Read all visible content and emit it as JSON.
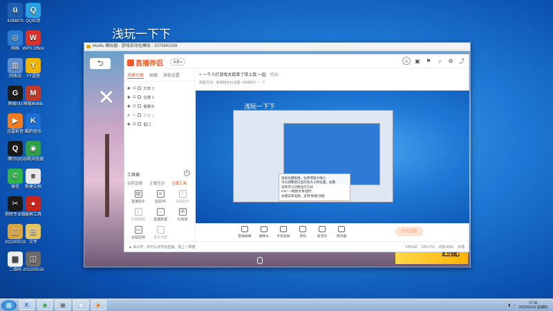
{
  "desktop": {
    "icons": [
      {
        "label": "4298879",
        "glyph": "ü",
        "color": "#1f5fb0"
      },
      {
        "label": "QQ应用",
        "glyph": "Q",
        "color": "#2aa0e0"
      },
      {
        "label": "网络",
        "glyph": "◎",
        "color": "#2a7bd0"
      },
      {
        "label": "WPS Office",
        "glyph": "W",
        "color": "#d8322b"
      },
      {
        "label": "回收站",
        "glyph": "▥",
        "color": "#5d8ccf"
      },
      {
        "label": "YY语音",
        "glyph": "Y",
        "color": "#f0b400"
      },
      {
        "label": "网易UU",
        "glyph": "G",
        "color": "#1b1b1b"
      },
      {
        "label": "网易MuMu",
        "glyph": "M",
        "color": "#c03a2a"
      },
      {
        "label": "迅雷影音",
        "glyph": "▶",
        "color": "#ef7b22"
      },
      {
        "label": "酷狗音乐",
        "glyph": "K",
        "color": "#1b6ed6"
      },
      {
        "label": "腾讯QQ",
        "glyph": "Q",
        "color": "#1a1a1a"
      },
      {
        "label": "谷歌浏览器",
        "glyph": "◉",
        "color": "#2e9e49"
      },
      {
        "label": "微信",
        "glyph": "✆",
        "color": "#2fb34a"
      },
      {
        "label": "新建文档",
        "glyph": "≡",
        "color": "#e8e8e8"
      },
      {
        "label": "剪映专业版",
        "glyph": "✂",
        "color": "#1a1a1a"
      },
      {
        "label": "录屏工具",
        "glyph": "●",
        "color": "#c7261c"
      },
      {
        "label": "2022/05/19",
        "glyph": "◫",
        "color": "#d9a441"
      },
      {
        "label": "文件",
        "glyph": "▤",
        "color": "#e5c462"
      },
      {
        "label": "二维码",
        "glyph": "▦",
        "color": "#eeeeee"
      },
      {
        "label": "2022/05/18",
        "glyph": "◫",
        "color": "#6a6a6a"
      }
    ],
    "overlay_text": "浅玩一下下"
  },
  "window": {
    "title": "MuMu 模拟器 - 游戏自动化模拟 - 3275891509"
  },
  "game": {
    "back_glyph": "⮌",
    "match_label": "匹配"
  },
  "panel": {
    "logo": "直播伴侣",
    "badge": "设置 ▸",
    "tabs": [
      {
        "label": "场景切换",
        "active": true
      },
      {
        "label": "画面",
        "active": false
      },
      {
        "label": "其他设置",
        "active": false
      }
    ],
    "scenes": [
      {
        "label": "文本 2",
        "dim": false
      },
      {
        "label": "全屏 1",
        "dim": false
      },
      {
        "label": "摄像头",
        "dim": false
      },
      {
        "label": "文本 1",
        "dim": true
      },
      {
        "label": "窗口",
        "dim": false
      }
    ],
    "tools_label": "工具箱",
    "tools_tabs": [
      {
        "label": "玩转直播",
        "active": false
      },
      {
        "label": "主播互动",
        "active": false
      },
      {
        "label": "主播工具",
        "active": true
      }
    ],
    "tools": [
      {
        "label": "直播助手",
        "glyph": "▤",
        "dim": false
      },
      {
        "label": "全民PK",
        "glyph": "⚔",
        "dim": false
      },
      {
        "label": "点歌助手",
        "glyph": "↧",
        "dim": true
      },
      {
        "label": "礼物特效",
        "glyph": "↥",
        "dim": true
      },
      {
        "label": "直播数据",
        "glyph": "♡",
        "dim": false
      },
      {
        "label": "礼物墙",
        "glyph": "✉",
        "dim": false
      },
      {
        "label": "远程控制",
        "glyph": "▭",
        "dim": false
      },
      {
        "label": "更多功能",
        "glyph": "⋯",
        "dim": true
      }
    ],
    "stream_title": "一个人打游戏太孤单了带上我 一起",
    "stream_title_tag": "修改",
    "stream_sub": "观看行动  ·  房间粉丝已设置: 4298879  ·  ♡ 0",
    "preview_text": "浅玩一下下",
    "tooltip_lines": [
      "鼠标左键拖拽、拉伸或放大缩小",
      "可以调整窗口显示的大小和位置，右键",
      "菜单可以切换显示方式",
      "Ctrl + V粘贴文本/图片",
      "右键菜单选择，支持“拖拽”功能"
    ],
    "bottom_items": [
      {
        "label": "直播屏幕",
        "name": "screen-share"
      },
      {
        "label": "摄像头",
        "name": "camera"
      },
      {
        "label": "手机投屏",
        "name": "phone-cast"
      },
      {
        "label": "游戏",
        "name": "game"
      },
      {
        "label": "麦克风",
        "name": "microphone"
      },
      {
        "label": "扬声器",
        "name": "speaker"
      }
    ],
    "start_live": "开始直播",
    "status_left": "▲ 未公开，你可以点开始直播，更上一层楼",
    "status_right": [
      "FPS:60",
      "CPU:7%",
      "内存:43%",
      "本场"
    ]
  },
  "taskbar": {
    "clock_time": "17:35",
    "clock_date": "2022/05/19 星期四",
    "apps": [
      {
        "glyph": "K",
        "color": "#1b6ed6"
      },
      {
        "glyph": "◉",
        "color": "#2e9e49"
      },
      {
        "glyph": "▦",
        "color": "#5a5a5a"
      },
      {
        "glyph": "●",
        "color": "#ffffff"
      },
      {
        "glyph": "▶",
        "color": "#ef7b22"
      }
    ]
  }
}
